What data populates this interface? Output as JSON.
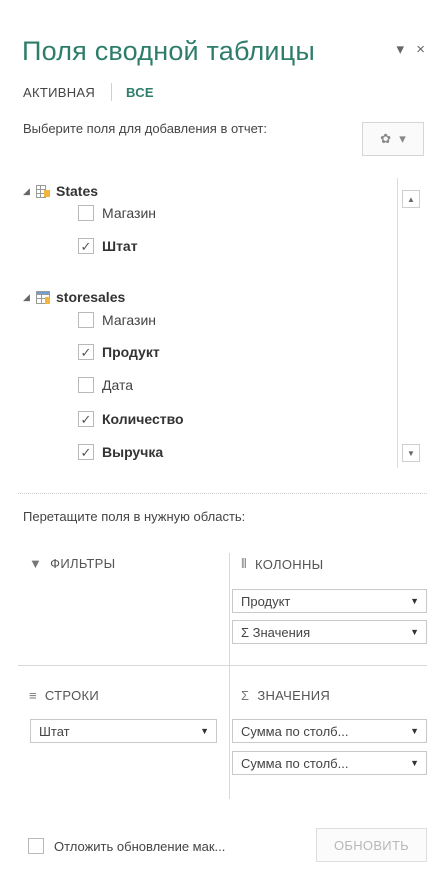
{
  "pane": {
    "title": "Поля сводной таблицы",
    "controls": {
      "dropdown": "▾",
      "close": "×"
    }
  },
  "tabs": [
    {
      "label": "АКТИВНАЯ",
      "active": false
    },
    {
      "label": "ВСЕ",
      "active": true
    }
  ],
  "instruction": "Выберите поля для добавления в отчет:",
  "tables": [
    {
      "name": "States",
      "fields": [
        {
          "label": "Магазин",
          "checked": false
        },
        {
          "label": "Штат",
          "checked": true
        }
      ]
    },
    {
      "name": "storesales",
      "fields": [
        {
          "label": "Магазин",
          "checked": false
        },
        {
          "label": "Продукт",
          "checked": true
        },
        {
          "label": "Дата",
          "checked": false
        },
        {
          "label": "Количество",
          "checked": true
        },
        {
          "label": "Выручка",
          "checked": true
        }
      ]
    }
  ],
  "drag_instruction": "Перетащите поля в нужную область:",
  "areas": {
    "filters": {
      "label": "ФИЛЬТРЫ",
      "items": []
    },
    "columns": {
      "label": "КОЛОННЫ",
      "items": [
        "Продукт",
        "Σ  Значения"
      ]
    },
    "rows": {
      "label": "СТРОКИ",
      "items": [
        "Штат"
      ]
    },
    "values": {
      "label": "ЗНАЧЕНИЯ",
      "items": [
        "Сумма по столб...",
        "Сумма по столб..."
      ]
    }
  },
  "footer": {
    "defer_label": "Отложить обновление мак...",
    "defer_checked": false,
    "update_label": "ОБНОВИТЬ"
  },
  "colors": {
    "accent": "#2e7d6a"
  }
}
